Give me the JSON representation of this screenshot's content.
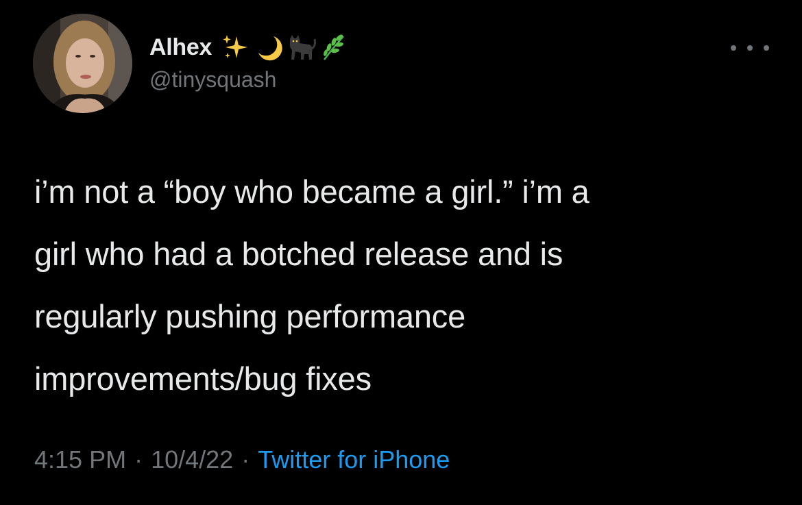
{
  "tweet": {
    "author": {
      "display_name": "Alhex",
      "name_emojis": [
        "sparkles-icon",
        "crescent-moon-icon",
        "black-cat-icon",
        "herb-icon"
      ],
      "handle": "@tinysquash"
    },
    "text": "i’m not a “boy who became a girl.” i’m a\ngirl who had a botched release and is\nregularly pushing performance\nimprovements/bug fixes",
    "time": "4:15 PM",
    "date": "10/4/22",
    "separator": "·",
    "source": "Twitter for iPhone",
    "more_icon": "more-options-icon"
  },
  "colors": {
    "background": "#000000",
    "text_primary": "#e7e9ea",
    "text_secondary": "#71767b",
    "link": "#1d9bf0"
  }
}
